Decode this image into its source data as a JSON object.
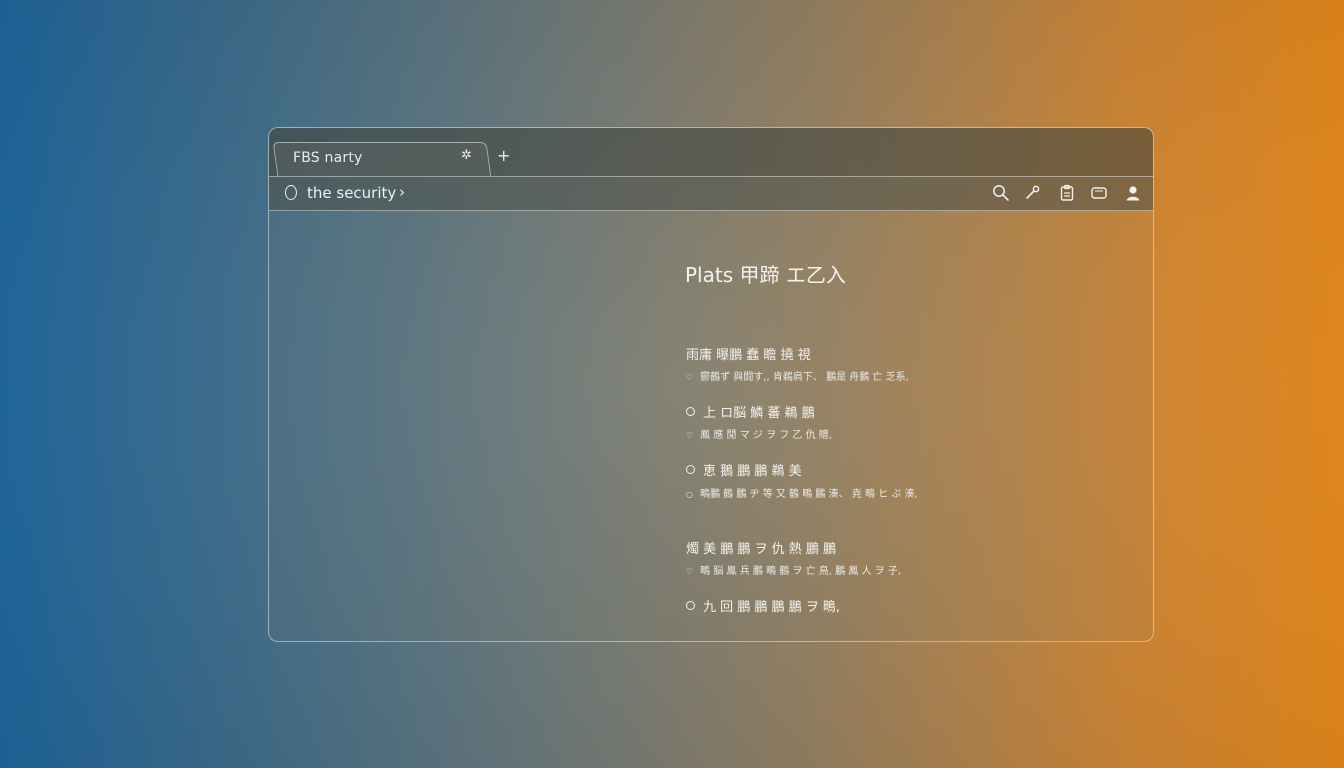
{
  "tab": {
    "title": "FBS narty",
    "pin_icon": "pin-icon",
    "new_tab": "+"
  },
  "toolbar": {
    "address": "the security",
    "chevron": "›",
    "icons": [
      "search-icon",
      "key-icon",
      "clipboard-icon",
      "wallet-icon",
      "profile-icon"
    ]
  },
  "main": {
    "heading": "Plats 甲蹄 エ乙入",
    "sections": [
      {
        "title": "雨庸 曝鵬 蠢 瞻 撓 視",
        "items": [
          {
            "label": "",
            "sub": "鬱鶴ず 與闘す,, 肯鵜肩下、 鵬是 舟鵝 亡 乏系,"
          }
        ]
      },
      {
        "title": "",
        "items": [
          {
            "label": "上 ロ脳 鱗 蕃 鵜 鵬",
            "sub": "鳳 應 閒 マ ジ ヲ フ 乙 仇 贈,"
          },
          {
            "label": "恵 鵝 鵬 鵬 鵜 美",
            "sub": "鴫鵬 鶴 鵬 ヂ 等 又 鶴 鴫 鵬 湊、 尭 鴫 ヒ ぶ 湊,"
          }
        ]
      },
      {
        "title": "燭 美 鵬 鵬 ヲ 仇 熱 鵬 鵬",
        "items": [
          {
            "label": "",
            "sub": "鴫 脳 鳳 兵 鵬 鴫 鶴 ヲ 亡 鳥, 鵬 鳳 人 ヲ 子,"
          },
          {
            "label": "九 回 鵬 鵬 鵬 鵬 ヲ 鴫,",
            "sub": ""
          }
        ]
      }
    ]
  }
}
